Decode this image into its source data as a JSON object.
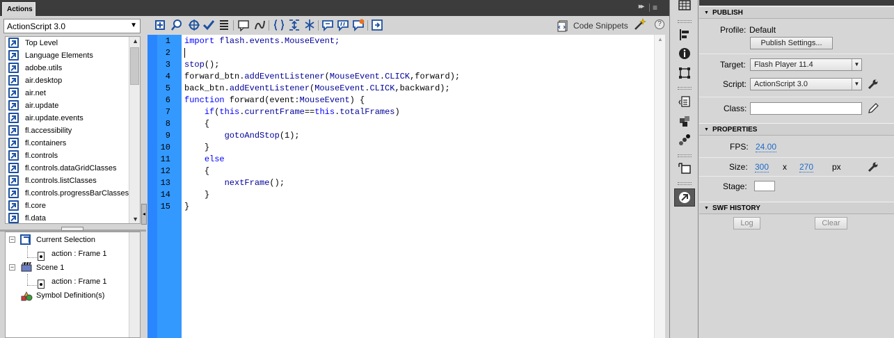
{
  "actions_panel": {
    "tab_label": "Actions",
    "collapse_glyph": "▸▸",
    "menu_glyph": "≡",
    "language_select": {
      "value": "ActionScript 3.0"
    },
    "toolbox_items": [
      "Top Level",
      "Language Elements",
      "adobe.utils",
      "air.desktop",
      "air.net",
      "air.update",
      "air.update.events",
      "fl.accessibility",
      "fl.containers",
      "fl.controls",
      "fl.controls.dataGridClasses",
      "fl.controls.listClasses",
      "fl.controls.progressBarClasses",
      "fl.core",
      "fl.data"
    ],
    "script_navigator": {
      "current_selection": "Current Selection",
      "current_frame": "action : Frame 1",
      "scene": "Scene 1",
      "scene_frame": "action : Frame 1",
      "symbol_definitions": "Symbol Definition(s)"
    },
    "code_snippets_label": "Code Snippets",
    "help_glyph": "?",
    "line_numbers": [
      "1",
      "2",
      "3",
      "4",
      "5",
      "6",
      "7",
      "8",
      "9",
      "10",
      "11",
      "12",
      "13",
      "14",
      "15"
    ]
  },
  "properties_panel": {
    "publish": {
      "header": "PUBLISH",
      "profile_label": "Profile:",
      "profile_value": "Default",
      "publish_settings_button": "Publish Settings...",
      "target_label": "Target:",
      "target_value": "Flash Player 11.4",
      "script_label": "Script:",
      "script_value": "ActionScript 3.0",
      "class_label": "Class:",
      "class_value": ""
    },
    "properties": {
      "header": "PROPERTIES",
      "fps_label": "FPS:",
      "fps_value": "24.00",
      "size_label": "Size:",
      "width_value": "300",
      "size_x": "x",
      "height_value": "270",
      "size_unit": "px",
      "stage_label": "Stage:",
      "stage_color": "#ffffff"
    },
    "swf_history": {
      "header": "SWF HISTORY",
      "log_button": "Log",
      "clear_button": "Clear"
    }
  },
  "colors": {
    "gutter": "#3399ff",
    "keyword": "#0000ff",
    "identifier": "#000099",
    "link": "#1e6bc9"
  }
}
